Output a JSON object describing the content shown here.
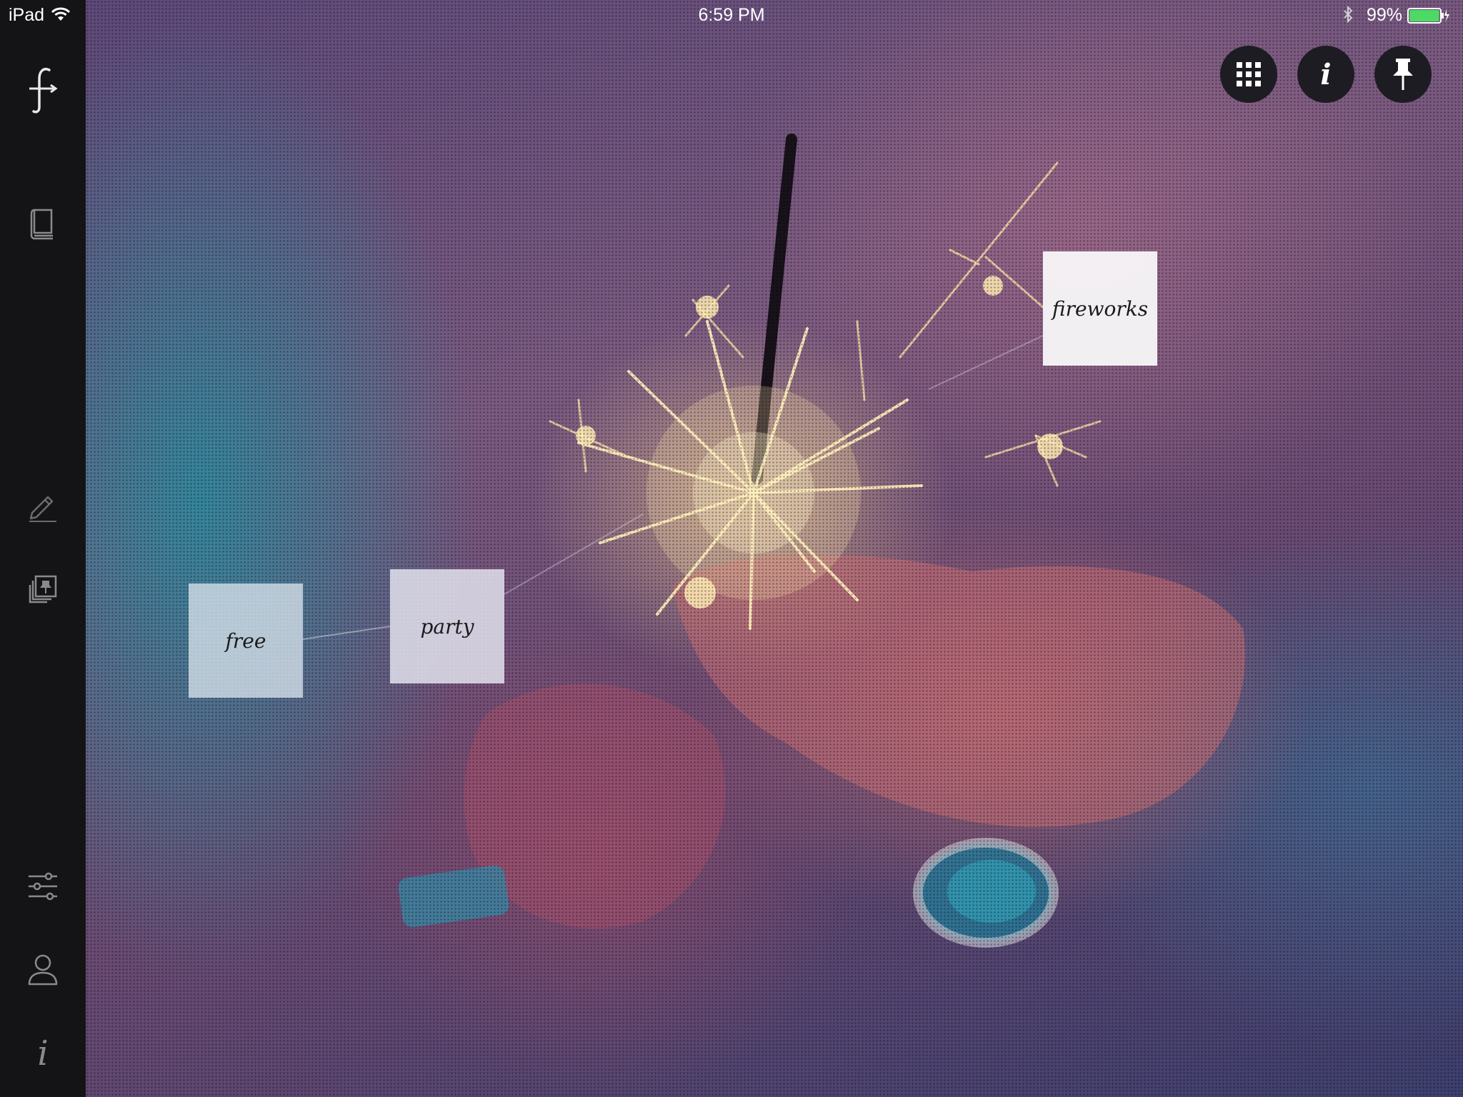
{
  "status_bar": {
    "device": "iPad",
    "time": "6:59 PM",
    "battery_percent": "99%",
    "battery_level": 0.99,
    "wifi_icon": "wifi-icon",
    "bluetooth_icon": "bluetooth-icon"
  },
  "sidebar": {
    "logo_icon": "fontli-logo-icon",
    "items": [
      {
        "icon": "book-icon"
      },
      {
        "icon": "pencil-icon"
      },
      {
        "icon": "pinned-stack-icon"
      },
      {
        "icon": "sliders-icon"
      },
      {
        "icon": "profile-icon"
      },
      {
        "icon": "info-icon",
        "glyph": "i"
      }
    ]
  },
  "actions": {
    "grid": {
      "icon": "grid-icon"
    },
    "info": {
      "icon": "info-icon",
      "glyph": "i"
    },
    "pin": {
      "icon": "pin-icon"
    }
  },
  "tags": [
    {
      "label": "free"
    },
    {
      "label": "party"
    },
    {
      "label": "fireworks"
    }
  ],
  "colors": {
    "sidebar_bg": "#141416",
    "button_bg": "#1d1c22",
    "battery_green": "#4cd964"
  }
}
